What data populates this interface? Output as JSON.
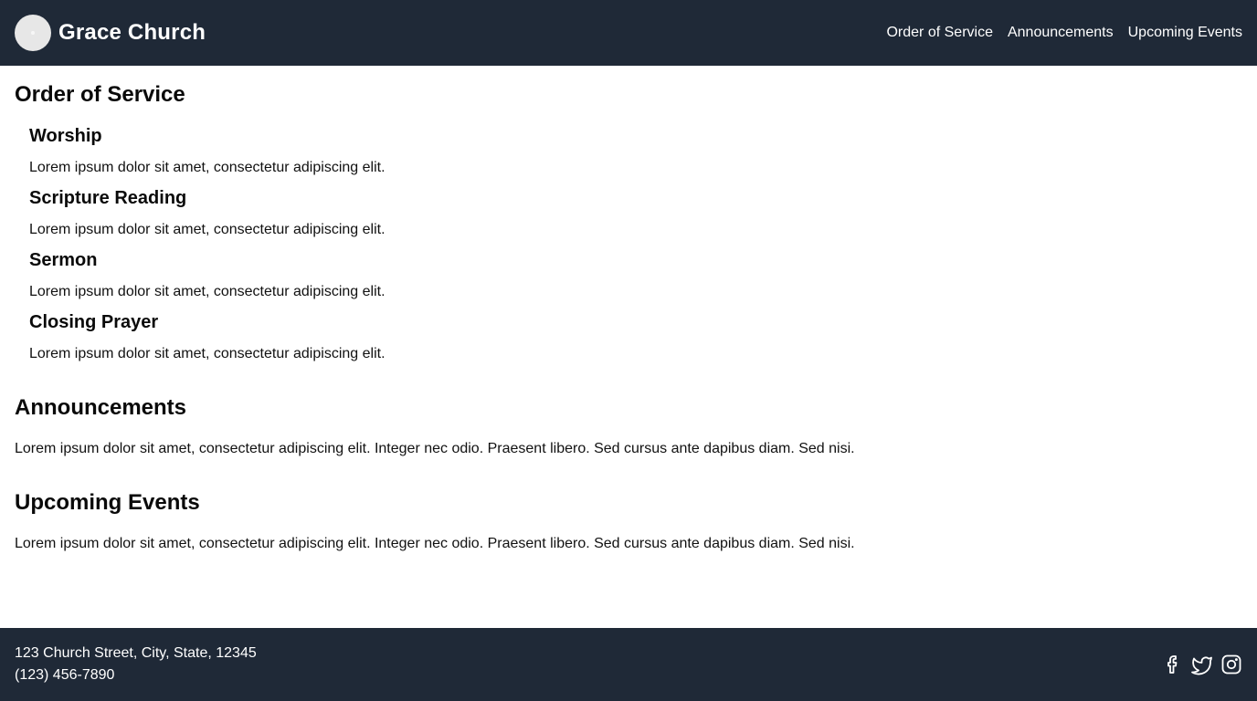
{
  "header": {
    "brand_name": "Grace Church",
    "nav": [
      {
        "label": "Order of Service"
      },
      {
        "label": "Announcements"
      },
      {
        "label": "Upcoming Events"
      }
    ]
  },
  "order_of_service": {
    "title": "Order of Service",
    "items": [
      {
        "heading": "Worship",
        "text": "Lorem ipsum dolor sit amet, consectetur adipiscing elit."
      },
      {
        "heading": "Scripture Reading",
        "text": "Lorem ipsum dolor sit amet, consectetur adipiscing elit."
      },
      {
        "heading": "Sermon",
        "text": "Lorem ipsum dolor sit amet, consectetur adipiscing elit."
      },
      {
        "heading": "Closing Prayer",
        "text": "Lorem ipsum dolor sit amet, consectetur adipiscing elit."
      }
    ]
  },
  "announcements": {
    "title": "Announcements",
    "text": "Lorem ipsum dolor sit amet, consectetur adipiscing elit. Integer nec odio. Praesent libero. Sed cursus ante dapibus diam. Sed nisi."
  },
  "upcoming_events": {
    "title": "Upcoming Events",
    "text": "Lorem ipsum dolor sit amet, consectetur adipiscing elit. Integer nec odio. Praesent libero. Sed cursus ante dapibus diam. Sed nisi."
  },
  "footer": {
    "address": "123 Church Street, City, State, 12345",
    "phone": "(123) 456-7890",
    "socials": [
      {
        "icon": "facebook-icon"
      },
      {
        "icon": "twitter-icon"
      },
      {
        "icon": "instagram-icon"
      }
    ]
  },
  "colors": {
    "bar_background": "#1f2937",
    "bar_text": "#ffffff",
    "body_background": "#ffffff",
    "body_text": "#111111"
  }
}
